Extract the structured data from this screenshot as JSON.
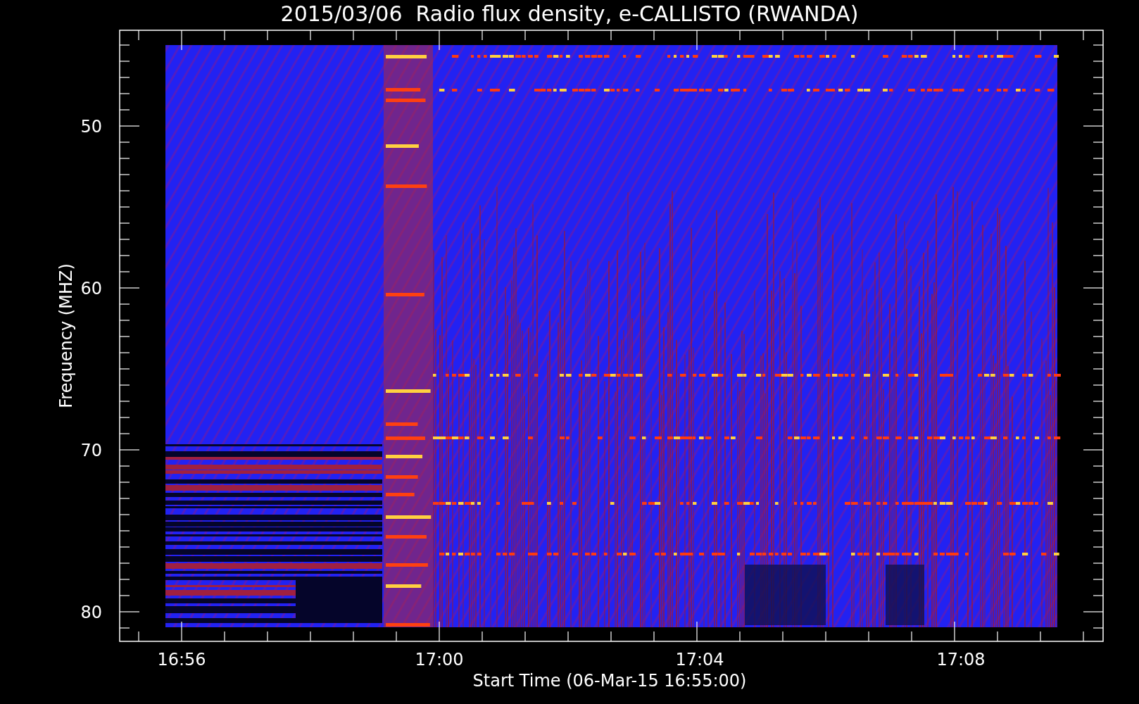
{
  "title": "2015/03/06  Radio flux density, e-CALLISTO (RWANDA)",
  "y_axis": {
    "label": "Frequency (MHZ)",
    "ticks": [
      "50",
      "60",
      "70",
      "80"
    ]
  },
  "x_axis": {
    "label": "Start Time (06-Mar-15 16:55:00)",
    "ticks": [
      "16:56",
      "17:00",
      "17:04",
      "17:08"
    ]
  }
}
